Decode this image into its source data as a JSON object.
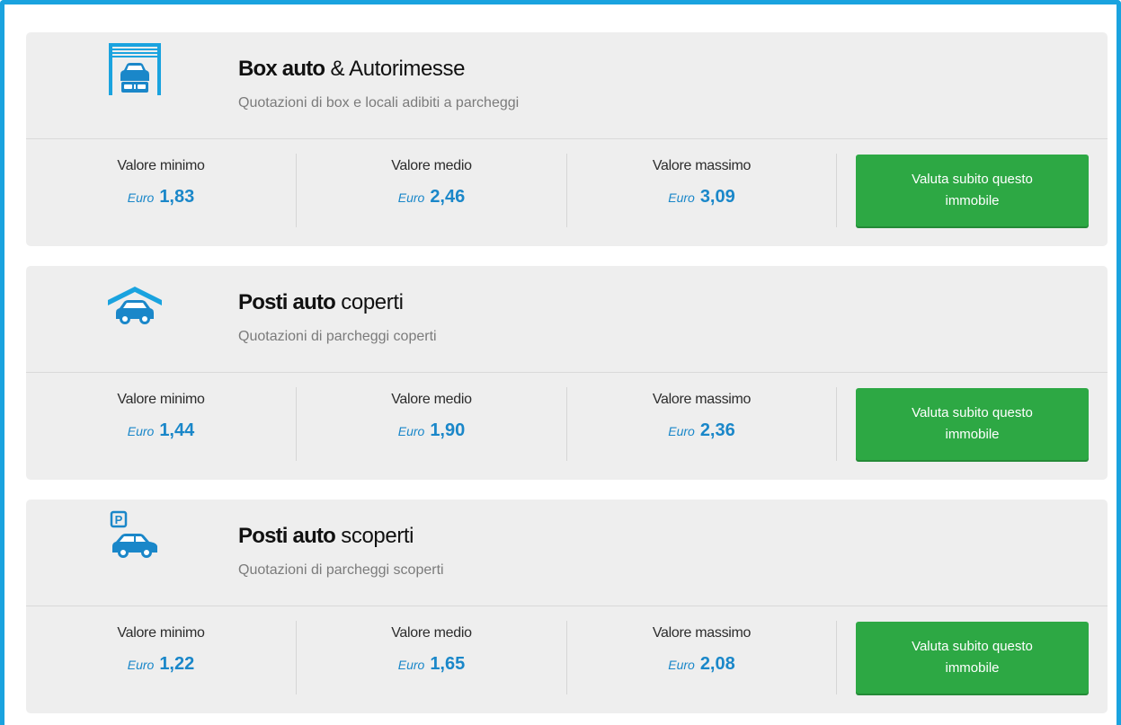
{
  "colors": {
    "accent": "#1aa3df",
    "price": "#1a87c9",
    "button": "#2da844",
    "card": "#eeeeee"
  },
  "cards": [
    {
      "icon": "garage-box-icon",
      "title_bold": "Box auto",
      "title_rest": " & Autorimesse",
      "subtitle": "Quotazioni di box e locali adibiti a parcheggi",
      "min_label": "Valore minimo",
      "min_currency": "Euro",
      "min_value": "1,83",
      "mid_label": "Valore medio",
      "mid_currency": "Euro",
      "mid_value": "2,46",
      "max_label": "Valore massimo",
      "max_currency": "Euro",
      "max_value": "3,09",
      "button": "Valuta subito questo immobile"
    },
    {
      "icon": "covered-parking-icon",
      "title_bold": "Posti auto",
      "title_rest": " coperti",
      "subtitle": "Quotazioni di parcheggi coperti",
      "min_label": "Valore minimo",
      "min_currency": "Euro",
      "min_value": "1,44",
      "mid_label": "Valore medio",
      "mid_currency": "Euro",
      "mid_value": "1,90",
      "max_label": "Valore massimo",
      "max_currency": "Euro",
      "max_value": "2,36",
      "button": "Valuta subito questo immobile"
    },
    {
      "icon": "open-parking-icon",
      "title_bold": "Posti auto",
      "title_rest": " scoperti",
      "subtitle": "Quotazioni di parcheggi scoperti",
      "parking_letter": "P",
      "min_label": "Valore minimo",
      "min_currency": "Euro",
      "min_value": "1,22",
      "mid_label": "Valore medio",
      "mid_currency": "Euro",
      "mid_value": "1,65",
      "max_label": "Valore massimo",
      "max_currency": "Euro",
      "max_value": "2,08",
      "button": "Valuta subito questo immobile"
    }
  ]
}
